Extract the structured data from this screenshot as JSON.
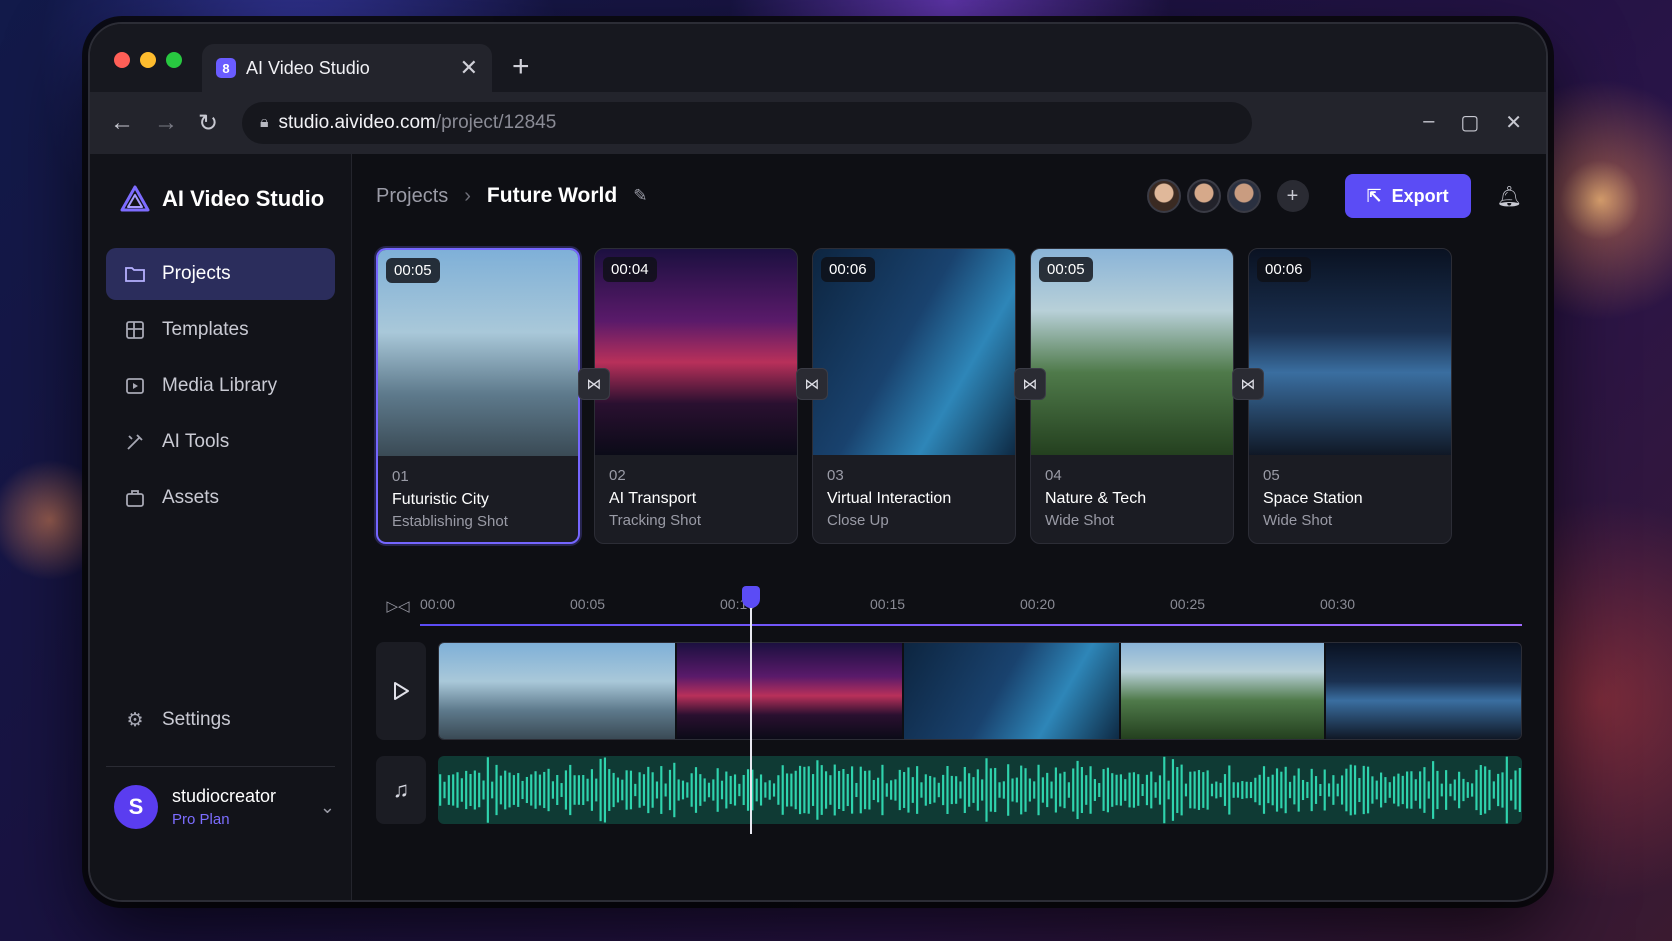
{
  "browser": {
    "tab_title": "AI Video Studio",
    "url_host": "studio.aivideo.com",
    "url_path": "/project/12845"
  },
  "sidebar": {
    "brand": "AI Video Studio",
    "items": [
      {
        "label": "Projects",
        "icon": "folder-icon",
        "active": true
      },
      {
        "label": "Templates",
        "icon": "templates-icon",
        "active": false
      },
      {
        "label": "Media Library",
        "icon": "media-library-icon",
        "active": false
      },
      {
        "label": "AI Tools",
        "icon": "ai-tools-icon",
        "active": false
      },
      {
        "label": "Assets",
        "icon": "assets-icon",
        "active": false
      }
    ],
    "settings_label": "Settings",
    "user": {
      "initial": "S",
      "name": "studiocreator",
      "plan": "Pro Plan"
    }
  },
  "header": {
    "breadcrumb_root": "Projects",
    "breadcrumb_current": "Future World",
    "export_label": "Export"
  },
  "scenes": [
    {
      "duration": "00:05",
      "number": "01",
      "title": "Futuristic City",
      "shot": "Establishing Shot",
      "selected": true
    },
    {
      "duration": "00:04",
      "number": "02",
      "title": "AI Transport",
      "shot": "Tracking Shot",
      "selected": false
    },
    {
      "duration": "00:06",
      "number": "03",
      "title": "Virtual Interaction",
      "shot": "Close Up",
      "selected": false
    },
    {
      "duration": "00:05",
      "number": "04",
      "title": "Nature & Tech",
      "shot": "Wide Shot",
      "selected": false
    },
    {
      "duration": "00:06",
      "number": "05",
      "title": "Space Station",
      "shot": "Wide Shot",
      "selected": false
    }
  ],
  "timeline": {
    "ticks": [
      "00:00",
      "00:05",
      "00:10",
      "00:15",
      "00:20",
      "00:25",
      "00:30"
    ],
    "playhead_time": "00:09"
  },
  "colors": {
    "accent": "#5b4cf5",
    "audio_wave": "#2fd3ad"
  }
}
